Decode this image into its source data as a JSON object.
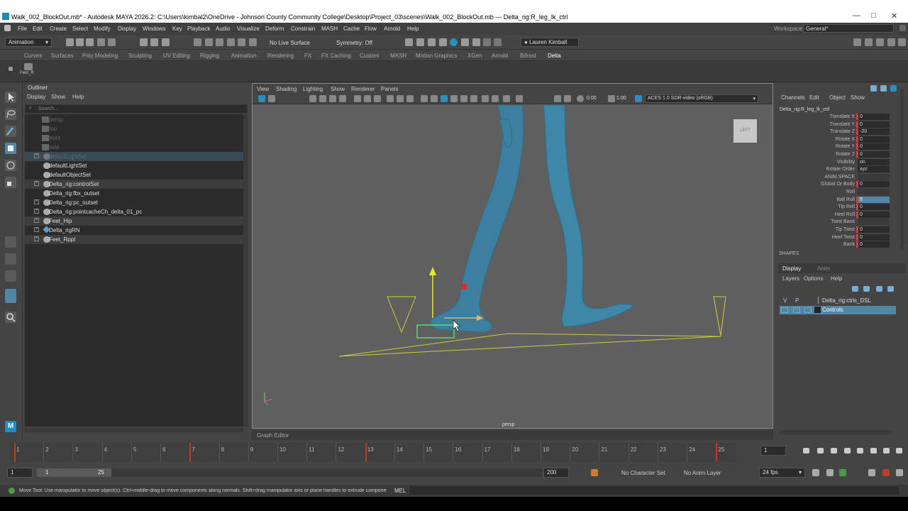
{
  "app": {
    "window_title": "Walk_002_BlockOut.mb* - Autodesk MAYA 2026.2: C:\\Users\\kimbal2\\OneDrive - Johnson County Community College\\Desktop\\Project_03\\scenes\\Walk_002_BlockOut.mb  ---  Delta_rig:R_leg_lk_ctrl",
    "workspace_label": "Workspace:",
    "workspace_value": "General*"
  },
  "menubar": [
    "File",
    "Edit",
    "Create",
    "Select",
    "Modify",
    "Display",
    "Windows",
    "Key",
    "Playback",
    "Audio",
    "Visualize",
    "Deform",
    "Constrain",
    "MASH",
    "Cache",
    "Flow",
    "Arnold",
    "Help"
  ],
  "statusline": {
    "menuset": "Animation",
    "live_surface": "No Live Surface",
    "symmetry": "Symmetry: Off",
    "user": "Lauren Kimball"
  },
  "shelf_tabs": [
    "Curves",
    "Surfaces",
    "Poly Modeling",
    "Sculpting",
    "UV Editing",
    "Rigging",
    "Animation",
    "Rendering",
    "FX",
    "FX Caching",
    "Custom",
    "MASH",
    "Motion Graphics",
    "XGen",
    "Arnold",
    "Bifrost",
    "Delta"
  ],
  "shelf_active": "Delta",
  "shelf_button_label": "Feet_R",
  "outliner": {
    "title": "Outliner",
    "menu": [
      "Display",
      "Show",
      "Help"
    ],
    "search_placeholder": "Search...",
    "items": [
      {
        "label": "persp",
        "dim": true,
        "expand": false
      },
      {
        "label": "top",
        "dim": true,
        "expand": false
      },
      {
        "label": "front",
        "dim": true,
        "expand": false
      },
      {
        "label": "side",
        "dim": true,
        "expand": false
      },
      {
        "label": "defaultLightSet",
        "dim": true,
        "expand": true,
        "selected": true
      },
      {
        "label": "defaultLightSet",
        "dim": false,
        "expand": false
      },
      {
        "label": "defaultObjectSet",
        "dim": false,
        "expand": false
      },
      {
        "label": "Delta_rig:controlSet",
        "dim": false,
        "expand": true
      },
      {
        "label": "Delta_rig:fbx_outset",
        "dim": false,
        "expand": false
      },
      {
        "label": "Delta_rig:pc_outset",
        "dim": false,
        "expand": true
      },
      {
        "label": "Delta_rig:pointcacheCh_delta_01_pc",
        "dim": false,
        "expand": true
      },
      {
        "label": "Feet_Hip",
        "dim": false,
        "expand": true,
        "selected": true
      },
      {
        "label": "Delta_rigRN",
        "dim": false,
        "expand": true
      },
      {
        "label": "Feet_Rppt",
        "dim": false,
        "expand": true,
        "selected": true
      }
    ]
  },
  "viewport": {
    "menu": [
      "View",
      "Shading",
      "Lighting",
      "Show",
      "Renderer",
      "Panels"
    ],
    "val_a": "0.00",
    "val_b": "1.00",
    "colorspace": "ACES 1.0 SDR-video (sRGB)",
    "camera": "persp",
    "viewcube": "LEFT"
  },
  "graph_editor_tab": "Graph Editor",
  "channelbox": {
    "menu": [
      "Channels",
      "Edit",
      "Object",
      "Show"
    ],
    "node": "Delta_rig:R_leg_lk_ctrl",
    "attrs": [
      {
        "name": "Translate X",
        "value": "0"
      },
      {
        "name": "Translate Y",
        "value": "0"
      },
      {
        "name": "Translate Z",
        "value": "-20"
      },
      {
        "name": "Rotate X",
        "value": "0"
      },
      {
        "name": "Rotate Y",
        "value": "0"
      },
      {
        "name": "Rotate Z",
        "value": "0"
      },
      {
        "name": "Visibility",
        "value": "on"
      },
      {
        "name": "Rotate Order",
        "value": "xyz"
      },
      {
        "name": "ANIM SPACE",
        "value": ""
      },
      {
        "name": "Global Or Body",
        "value": "0"
      },
      {
        "name": "Roll",
        "value": ""
      },
      {
        "name": "Ball Roll",
        "value": "5",
        "active": true
      },
      {
        "name": "Tip Roll",
        "value": "0"
      },
      {
        "name": "Heel Roll",
        "value": "0"
      },
      {
        "name": "Twist Bank",
        "value": ""
      },
      {
        "name": "Tip Twist",
        "value": "0"
      },
      {
        "name": "Heel Twist",
        "value": "0"
      },
      {
        "name": "Bank",
        "value": "0"
      }
    ],
    "shapes_label": "SHAPES"
  },
  "layers": {
    "tabs": [
      "Display",
      "Anim"
    ],
    "menu": [
      "Layers",
      "Options",
      "Help"
    ],
    "col_v": "V",
    "col_p": "P",
    "rows": [
      {
        "label": "Delta_rig:ctrls_DSL",
        "selected": false
      },
      {
        "label": "Controls",
        "selected": true
      }
    ]
  },
  "timeslider": {
    "ticks": [
      "1",
      "2",
      "3",
      "4",
      "5",
      "6",
      "7",
      "8",
      "9",
      "10",
      "11",
      "12",
      "13",
      "14",
      "15",
      "16",
      "17",
      "18",
      "19",
      "20",
      "21",
      "22",
      "23",
      "24",
      "25"
    ],
    "key_frames": [
      1,
      7,
      13,
      25
    ],
    "current_frame": "1"
  },
  "rangeslider": {
    "start": "1",
    "range_start": "1",
    "range_end": "25",
    "end": "200",
    "character_set": "No Character Set",
    "anim_layer": "No Anim Layer",
    "fps": "24 fps"
  },
  "helpline": {
    "text": "Move Tool: Use manipulator to move object(s). Ctrl+middle-drag to move components along normals. Shift+drag manipulator axis or plane handles to extrude components or t",
    "mel": "MEL"
  },
  "colors": {
    "accent": "#5285a6",
    "selection": "#5285a6",
    "keyframe": "#c0392b",
    "character": "#2e6e88"
  }
}
